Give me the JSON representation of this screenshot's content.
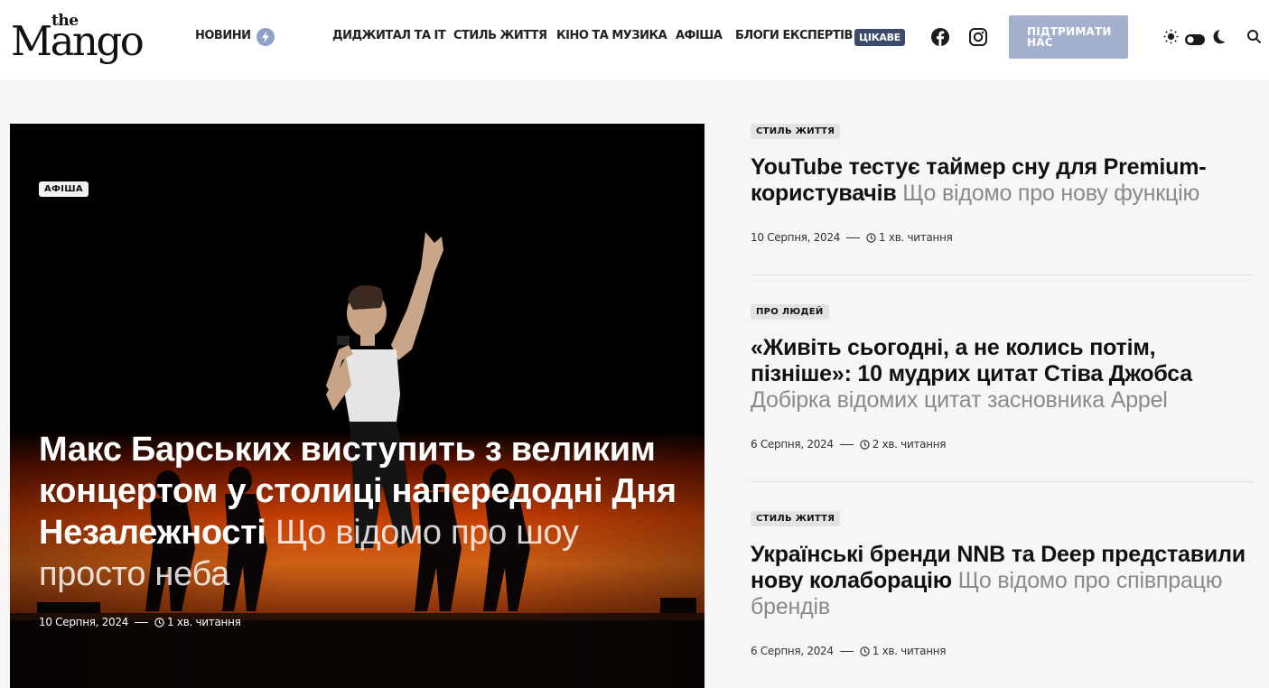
{
  "brand": {
    "the": "the",
    "name": "Mango"
  },
  "nav": {
    "news": "НОВИНИ",
    "digital": "ДИДЖИТАЛ ТА IT",
    "lifestyle": "СТИЛЬ ЖИТТЯ",
    "cinema": "КІНО ТА МУЗИКА",
    "afisha": "АФІША",
    "blogs": "БЛОГИ ЕКСПЕРТІВ",
    "cikave": "ЦІКАВЕ"
  },
  "header": {
    "support_label": "ПІДТРИМАТИ НАС",
    "icons": [
      "lightning-icon",
      "facebook-icon",
      "instagram-icon",
      "sun-icon",
      "toggle-icon",
      "moon-icon",
      "search-icon"
    ]
  },
  "hero": {
    "category": "АФІША",
    "title": "Макс Барських виступить з великим концертом у столиці напередодні Дня Незалежності",
    "subtitle": "Що відомо про шоу просто неба",
    "date": "10 Серпня, 2024",
    "read_time": "1 хв. читання"
  },
  "articles": [
    {
      "category": "СТИЛЬ ЖИТТЯ",
      "title": "YouTube тестує таймер сну для Premium-користувачів",
      "subtitle": "Що відомо про нову функцію",
      "date": "10 Серпня, 2024",
      "read_time": "1 хв. читання"
    },
    {
      "category": "ПРО ЛЮДЕЙ",
      "title": "«Живіть сьогодні, а не колись потім, пізніше»: 10 мудрих цитат Стіва Джобса",
      "subtitle": "Добірка відомих цитат засновника Appel",
      "date": "6 Серпня, 2024",
      "read_time": "2 хв. читання"
    },
    {
      "category": "СТИЛЬ ЖИТТЯ",
      "title": "Українські бренди NNB та Deep представили нову колаборацію",
      "subtitle": "Що відомо про співпрацю брендів",
      "date": "6 Серпня, 2024",
      "read_time": "1 хв. читання"
    }
  ],
  "colors": {
    "accent": "#a4b1cc",
    "badge": "#3c4a6b",
    "bolt": "#8ea2c8",
    "background": "#f6f6f6"
  }
}
